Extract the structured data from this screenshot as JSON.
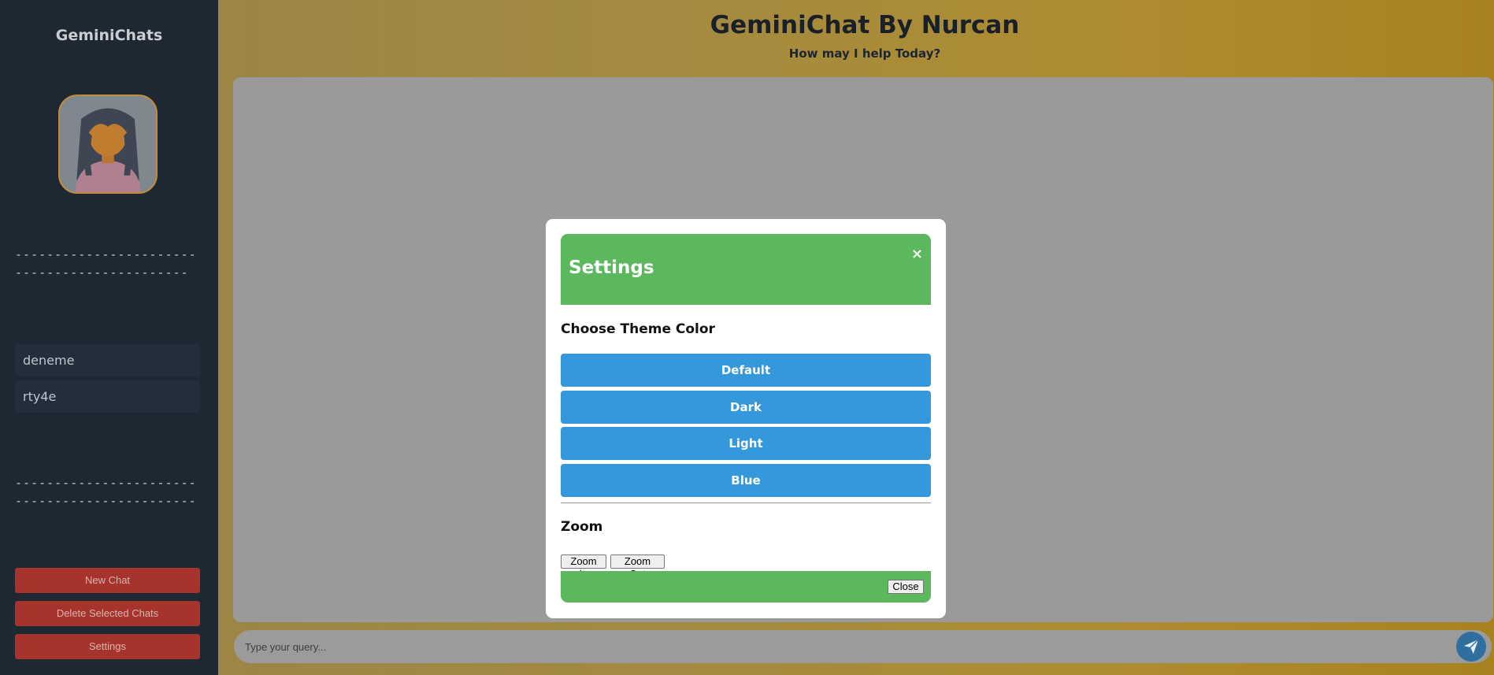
{
  "sidebar": {
    "brand": "GeminiChats",
    "avatar_icon": "woman-avatar-icon",
    "separator_top": "---------------------------------------------",
    "separator_bottom": "----------------------------------------------",
    "chats": [
      {
        "label": "deneme"
      },
      {
        "label": "rty4e"
      }
    ],
    "buttons": {
      "new_chat": "New Chat",
      "delete_selected": "Delete Selected Chats",
      "settings": "Settings"
    }
  },
  "header": {
    "title": "GeminiChat By Nurcan",
    "subtitle": "How may I help Today?"
  },
  "query": {
    "placeholder": "Type your query..."
  },
  "send_icon": "paper-plane-icon",
  "settings_modal": {
    "title": "Settings",
    "close_x": "×",
    "theme_heading": "Choose Theme Color",
    "themes": [
      {
        "label": "Default"
      },
      {
        "label": "Dark"
      },
      {
        "label": "Light"
      },
      {
        "label": "Blue"
      }
    ],
    "zoom_heading": "Zoom",
    "zoom_in": "Zoom In",
    "zoom_out": "Zoom Out",
    "close_label": "Close"
  },
  "colors": {
    "sidebar_bg": "#1e2833",
    "sidebar_button": "#a6342c",
    "modal_accent": "#5cb85c",
    "theme_button": "#3498db",
    "main_gradient_end": "#a7821f"
  }
}
